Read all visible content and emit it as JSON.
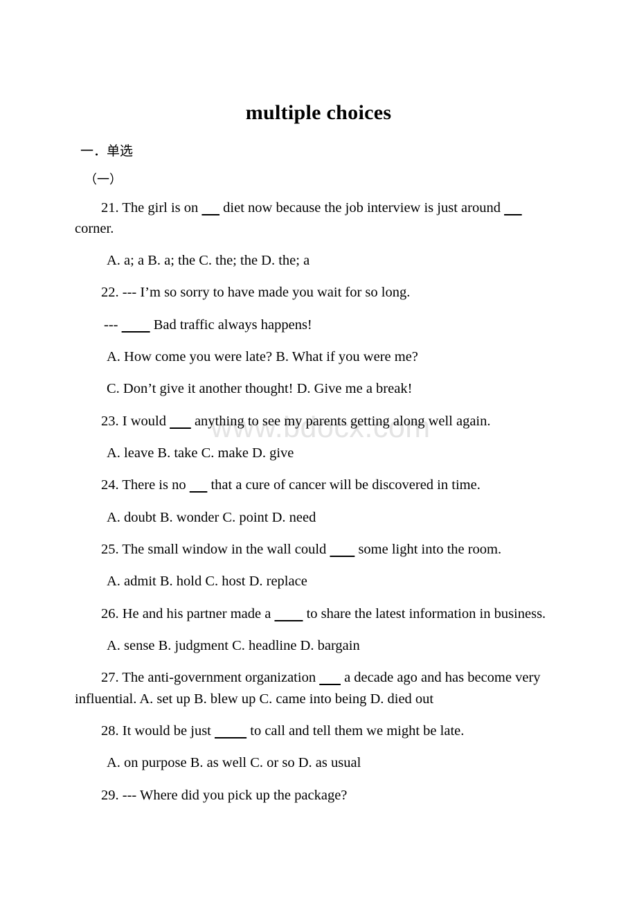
{
  "document": {
    "title": "multiple choices",
    "watermark": "www.bdocx.com",
    "section_heading": "一．单选",
    "section_subheading": "（一）",
    "questions": [
      {
        "stem_pre": "21. The girl is on ",
        "blank1": "     ",
        "stem_mid": " diet now because the job interview is just around ",
        "blank2": "     ",
        "stem_post": " corner.",
        "options": "A. a; a   B. a; the    C. the; the    D. the; a"
      },
      {
        "stem": "22. --- I’m so sorry to have made you wait for so long.",
        "reply_pre": "--- ",
        "reply_blank": "        ",
        "reply_post": " Bad traffic always happens!",
        "options_ab": "A. How come you were late?   B. What if you were me?",
        "options_cd": "C. Don’t give it another thought!  D. Give me a break!"
      },
      {
        "stem_pre": "23. I would ",
        "blank1": "      ",
        "stem_post": " anything to see my parents getting along well again.",
        "options": "A. leave   B. take   C. make    D. give"
      },
      {
        "stem_pre": "24. There is no ",
        "blank1": "     ",
        "stem_post": " that a cure of cancer will be discovered in time.",
        "options": "A. doubt   B. wonder   C. point     D. need"
      },
      {
        "stem_pre": "25. The small window in the wall could ",
        "blank1": "       ",
        "stem_post": " some light into the room.",
        "options": "A. admit   B. hold    C. host     D. replace"
      },
      {
        "stem_pre": "26. He and his partner made a ",
        "blank1": "        ",
        "stem_post": " to share the latest information in business.",
        "options": "A. sense  B. judgment   C. headline    D. bargain"
      },
      {
        "stem_pre": "27. The anti-government organization ",
        "blank1": "      ",
        "stem_post": " a decade ago and has become very influential.  A. set up B. blew up C. came into being  D. died out"
      },
      {
        "stem_pre": "28. It would be just ",
        "blank1": "         ",
        "stem_post": " to call and tell them we might be late.",
        "options": "A. on purpose  B. as well   C. or so     D. as usual"
      },
      {
        "stem": "29. --- Where did you pick up the package?"
      }
    ]
  }
}
